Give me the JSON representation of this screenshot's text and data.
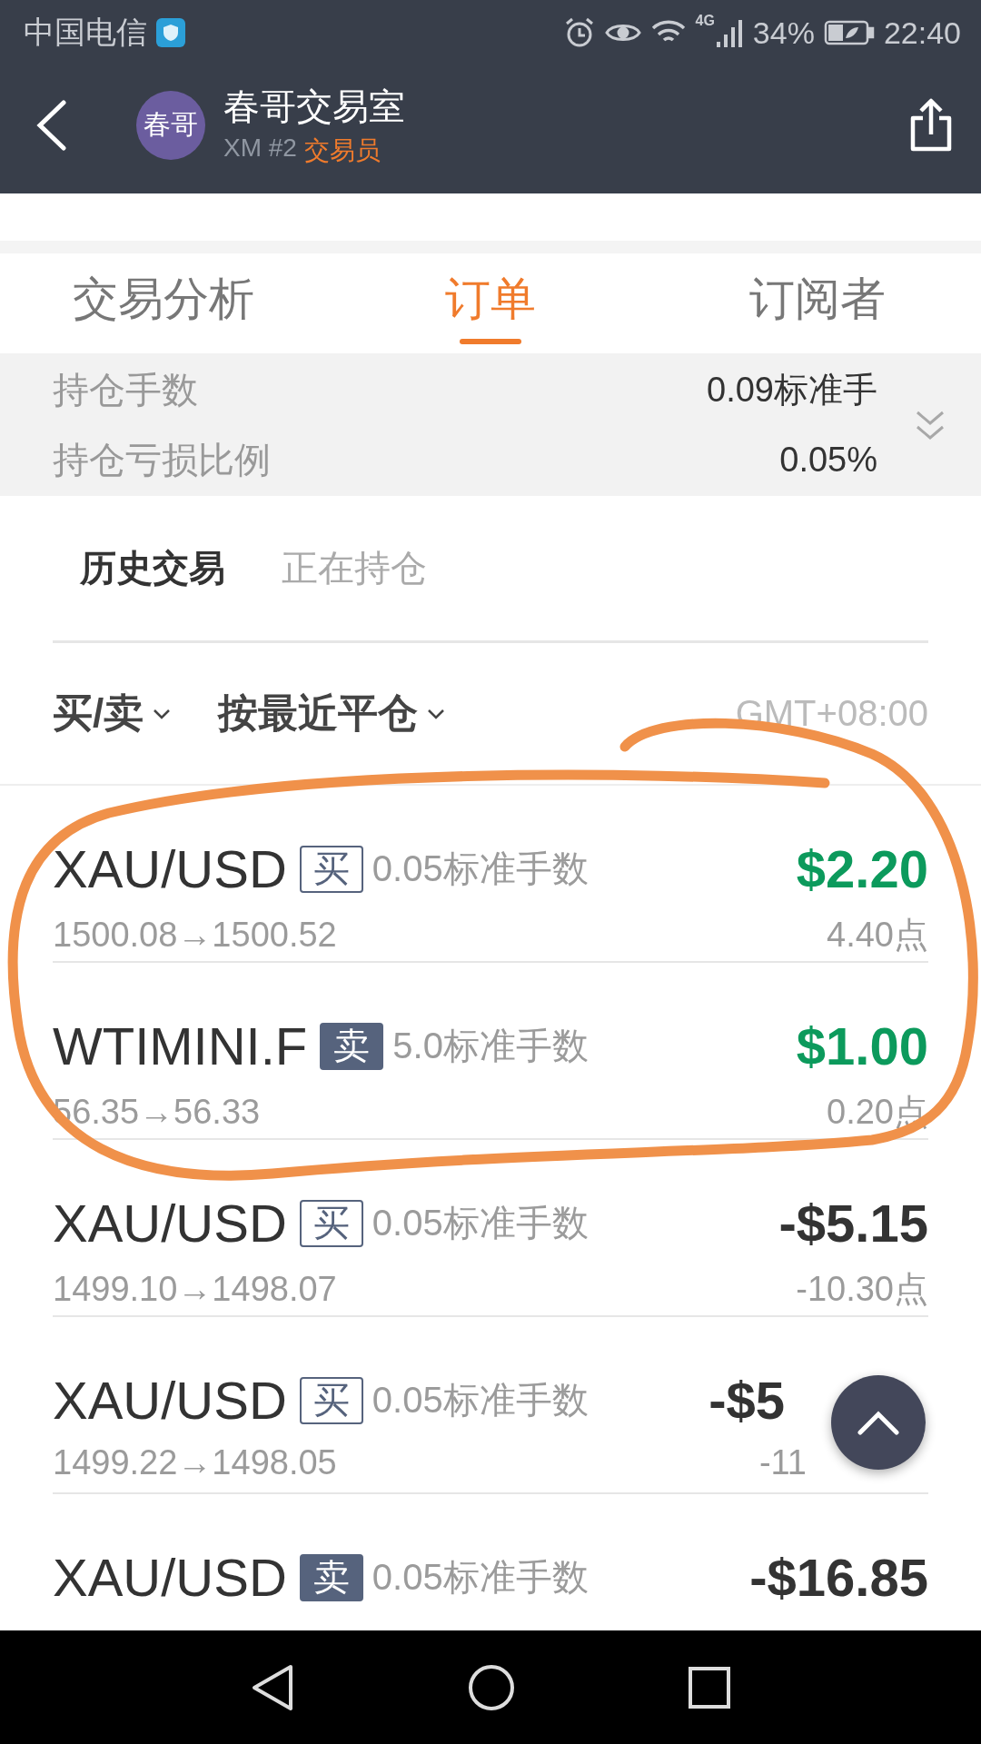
{
  "status_bar": {
    "carrier": "中国电信",
    "network": "4G",
    "battery": "34%",
    "time": "22:40"
  },
  "header": {
    "avatar": "春哥",
    "title": "春哥交易室",
    "subtitle": "XM #2",
    "role": "交易员"
  },
  "tabs": [
    {
      "label": "交易分析",
      "selected": false
    },
    {
      "label": "订单",
      "selected": true
    },
    {
      "label": "订阅者",
      "selected": false
    }
  ],
  "summary": [
    {
      "label": "持仓手数",
      "value": "0.09标准手"
    },
    {
      "label": "持仓亏损比例",
      "value": "0.05%"
    }
  ],
  "subtabs": [
    {
      "label": "历史交易",
      "selected": true
    },
    {
      "label": "正在持仓",
      "selected": false
    }
  ],
  "filters": [
    {
      "label": "买/卖"
    },
    {
      "label": "按最近平仓"
    }
  ],
  "timezone": "GMT+08:00",
  "trades": [
    {
      "symbol": "XAU/USD",
      "kind": "buy",
      "side_label": "买",
      "lots": "0.05标准手数",
      "amount": "$2.20",
      "gain": true,
      "prices": "1500.08→1500.52",
      "points": "4.40点"
    },
    {
      "symbol": "WTIMINI.F",
      "kind": "sell",
      "side_label": "卖",
      "lots": "5.0标准手数",
      "amount": "$1.00",
      "gain": true,
      "prices": "56.35→56.33",
      "points": "0.20点"
    },
    {
      "symbol": "XAU/USD",
      "kind": "buy",
      "side_label": "买",
      "lots": "0.05标准手数",
      "amount": "-$5.15",
      "gain": false,
      "prices": "1499.10→1498.07",
      "points": "-10.30点"
    },
    {
      "symbol": "XAU/USD",
      "kind": "buy",
      "side_label": "买",
      "lots": "0.05标准手数",
      "amount": "-$5",
      "gain": false,
      "covered": true,
      "prices": "1499.22→1498.05",
      "points": "-11"
    },
    {
      "symbol": "XAU/USD",
      "kind": "sell",
      "side_label": "卖",
      "lots": "0.05标准手数",
      "amount": "-$16.85",
      "gain": false
    }
  ]
}
